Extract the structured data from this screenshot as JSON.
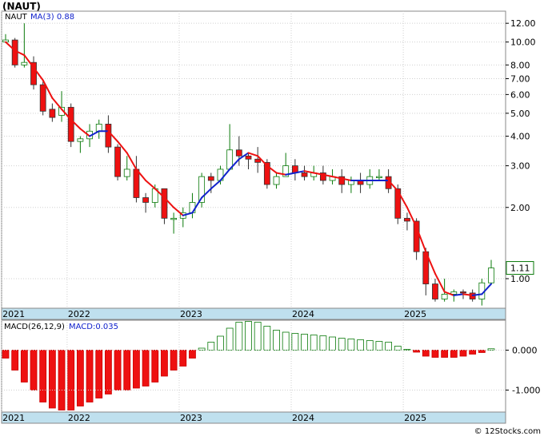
{
  "title": "(NAUT)",
  "colors": {
    "up_body": "#ffffff",
    "up_edge": "#0a7a0a",
    "down_body": "#ee1111",
    "down_edge": "#333333",
    "ma": "#ee1111",
    "ma_up": "#1122cc",
    "axis_band": "#bfe0ee"
  },
  "price_panel": {
    "legend_symbol": "NAUT",
    "legend_ma": "MA(3)",
    "legend_ma_value": "0.88",
    "last_price_label": "1.11",
    "y_ticks": [
      "12.00",
      "10.00",
      "8.00",
      "7.00",
      "6.00",
      "5.00",
      "4.00",
      "3.00",
      "2.00",
      "1.00"
    ]
  },
  "macd_panel": {
    "legend_label": "MACD(26,12,9)",
    "legend_value": "MACD:0.035",
    "y_ticks": [
      "0.000",
      "-1.000"
    ]
  },
  "x_years": [
    "2021",
    "2022",
    "2023",
    "2024",
    "2025"
  ],
  "watermark": "© 12Stocks.com",
  "chart_data": [
    {
      "type": "candlestick",
      "title": "(NAUT)",
      "y_scale": "log",
      "ylim": [
        0.75,
        13.5
      ],
      "series": [
        {
          "name": "NAUT",
          "values": "candles"
        },
        {
          "name": "MA(3)",
          "values": "ma"
        }
      ],
      "candles": [
        [
          10.0,
          10.2,
          10.8,
          9.9
        ],
        [
          10.2,
          8.0,
          10.4,
          7.8
        ],
        [
          8.0,
          8.2,
          12.0,
          7.8
        ],
        [
          8.2,
          6.6,
          8.7,
          6.3
        ],
        [
          6.6,
          5.1,
          6.8,
          4.9
        ],
        [
          5.2,
          4.8,
          5.5,
          4.6
        ],
        [
          4.9,
          5.3,
          6.2,
          4.6
        ],
        [
          5.3,
          3.8,
          5.5,
          3.6
        ],
        [
          3.8,
          3.9,
          4.0,
          3.4
        ],
        [
          3.9,
          4.2,
          4.5,
          3.6
        ],
        [
          4.2,
          4.5,
          4.7,
          3.9
        ],
        [
          4.5,
          3.6,
          4.9,
          3.4
        ],
        [
          3.6,
          2.7,
          3.7,
          2.6
        ],
        [
          2.7,
          2.9,
          3.3,
          2.6
        ],
        [
          2.9,
          2.2,
          3.3,
          2.1
        ],
        [
          2.2,
          2.1,
          2.3,
          1.9
        ],
        [
          2.1,
          2.4,
          2.5,
          2.0
        ],
        [
          2.4,
          1.8,
          2.4,
          1.7
        ],
        [
          1.8,
          1.8,
          1.9,
          1.55
        ],
        [
          1.8,
          1.9,
          2.0,
          1.65
        ],
        [
          1.9,
          2.1,
          2.3,
          1.8
        ],
        [
          2.1,
          2.7,
          2.8,
          2.0
        ],
        [
          2.7,
          2.6,
          2.8,
          2.3
        ],
        [
          2.6,
          2.9,
          3.0,
          2.5
        ],
        [
          2.9,
          3.5,
          4.5,
          2.9
        ],
        [
          3.5,
          3.3,
          4.0,
          3.0
        ],
        [
          3.3,
          3.2,
          3.4,
          2.9
        ],
        [
          3.2,
          3.1,
          3.6,
          2.8
        ],
        [
          3.1,
          2.5,
          3.2,
          2.4
        ],
        [
          2.5,
          2.7,
          2.8,
          2.4
        ],
        [
          2.7,
          3.0,
          3.4,
          2.7
        ],
        [
          3.0,
          2.8,
          3.2,
          2.6
        ],
        [
          2.8,
          2.7,
          3.0,
          2.6
        ],
        [
          2.7,
          2.8,
          3.0,
          2.6
        ],
        [
          2.8,
          2.6,
          3.0,
          2.5
        ],
        [
          2.6,
          2.7,
          2.9,
          2.5
        ],
        [
          2.7,
          2.5,
          2.9,
          2.3
        ],
        [
          2.5,
          2.6,
          2.7,
          2.3
        ],
        [
          2.6,
          2.5,
          2.8,
          2.3
        ],
        [
          2.5,
          2.7,
          2.9,
          2.4
        ],
        [
          2.7,
          2.7,
          2.9,
          2.6
        ],
        [
          2.7,
          2.4,
          2.9,
          2.3
        ],
        [
          2.4,
          1.8,
          2.5,
          1.7
        ],
        [
          1.8,
          1.75,
          1.9,
          1.6
        ],
        [
          1.75,
          1.3,
          1.8,
          1.2
        ],
        [
          1.3,
          0.95,
          1.35,
          0.85
        ],
        [
          0.95,
          0.82,
          1.0,
          0.8
        ],
        [
          0.82,
          0.86,
          1.0,
          0.8
        ],
        [
          0.86,
          0.88,
          0.9,
          0.8
        ],
        [
          0.88,
          0.87,
          0.9,
          0.82
        ],
        [
          0.87,
          0.82,
          0.9,
          0.8
        ],
        [
          0.82,
          0.96,
          1.0,
          0.77
        ],
        [
          0.96,
          1.11,
          1.2,
          0.95
        ]
      ],
      "ma": [
        10.0,
        9.2,
        8.8,
        7.8,
        6.9,
        5.8,
        5.2,
        4.7,
        4.3,
        4.0,
        4.2,
        4.2,
        3.8,
        3.4,
        2.9,
        2.6,
        2.4,
        2.2,
        2.0,
        1.85,
        1.9,
        2.2,
        2.4,
        2.6,
        2.9,
        3.2,
        3.4,
        3.3,
        3.0,
        2.8,
        2.75,
        2.8,
        2.85,
        2.8,
        2.75,
        2.7,
        2.65,
        2.6,
        2.6,
        2.6,
        2.6,
        2.6,
        2.35,
        2.0,
        1.65,
        1.3,
        1.05,
        0.88,
        0.85,
        0.86,
        0.85,
        0.86,
        0.95
      ]
    },
    {
      "type": "bar",
      "title": "MACD(26,12,9)",
      "ylim": [
        -1.55,
        0.75
      ],
      "values": [
        -0.2,
        -0.5,
        -0.8,
        -1.0,
        -1.3,
        -1.45,
        -1.5,
        -1.5,
        -1.4,
        -1.3,
        -1.2,
        -1.1,
        -1.0,
        -1.0,
        -0.95,
        -0.9,
        -0.8,
        -0.65,
        -0.5,
        -0.4,
        -0.2,
        0.05,
        0.2,
        0.35,
        0.55,
        0.7,
        0.72,
        0.7,
        0.6,
        0.5,
        0.45,
        0.42,
        0.4,
        0.38,
        0.36,
        0.33,
        0.3,
        0.28,
        0.26,
        0.24,
        0.22,
        0.2,
        0.1,
        0.02,
        -0.05,
        -0.15,
        -0.18,
        -0.18,
        -0.18,
        -0.15,
        -0.1,
        -0.06,
        0.035
      ]
    }
  ]
}
